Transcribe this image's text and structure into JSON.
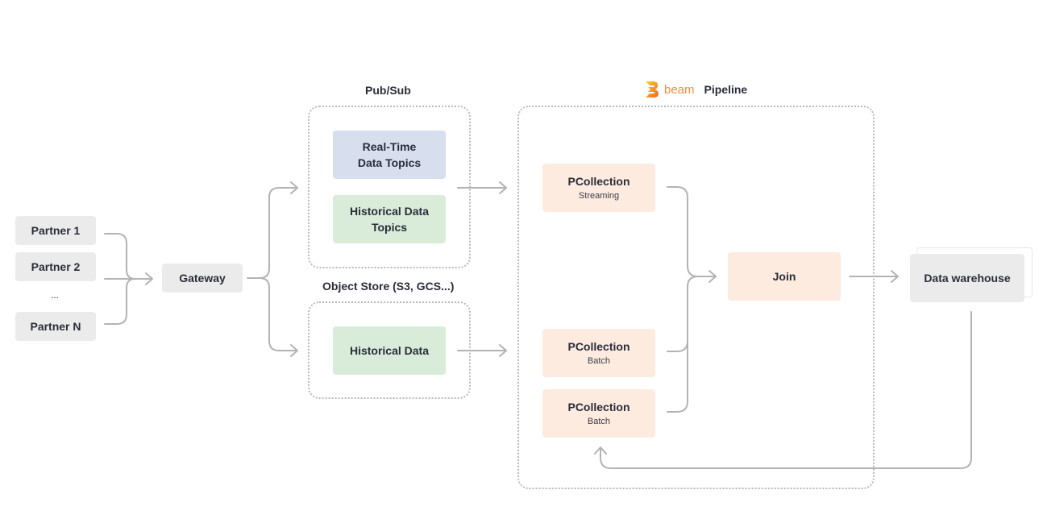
{
  "partners": {
    "items": [
      "Partner 1",
      "Partner 2",
      "Partner N"
    ],
    "ellipsis": "..."
  },
  "gateway": {
    "label": "Gateway"
  },
  "pubsub": {
    "title": "Pub/Sub",
    "realtime": {
      "line1": "Real-Time",
      "line2": "Data Topics",
      "color": "#d7deee"
    },
    "historical_topics": {
      "line1": "Historical Data",
      "line2": "Topics",
      "color": "#d8ecd9"
    }
  },
  "object_store": {
    "title": "Object Store (S3,  GCS...)",
    "historical": {
      "label": "Historical Data",
      "color": "#d8ecd9"
    }
  },
  "pipeline": {
    "logo_icon": "beam-logo-icon",
    "logo_text": "beam",
    "title": "Pipeline",
    "pcollections": [
      {
        "label": "PCollection",
        "sub": "Streaming"
      },
      {
        "label": "PCollection",
        "sub": "Batch"
      },
      {
        "label": "PCollection",
        "sub": "Batch"
      }
    ],
    "join": {
      "label": "Join"
    },
    "node_color": "#fdebe0"
  },
  "warehouse": {
    "label": "Data warehouse"
  },
  "colors": {
    "connector": "#b3b3b3",
    "group_border": "#b9b9b9",
    "beam_orange": "#f58a3b"
  }
}
